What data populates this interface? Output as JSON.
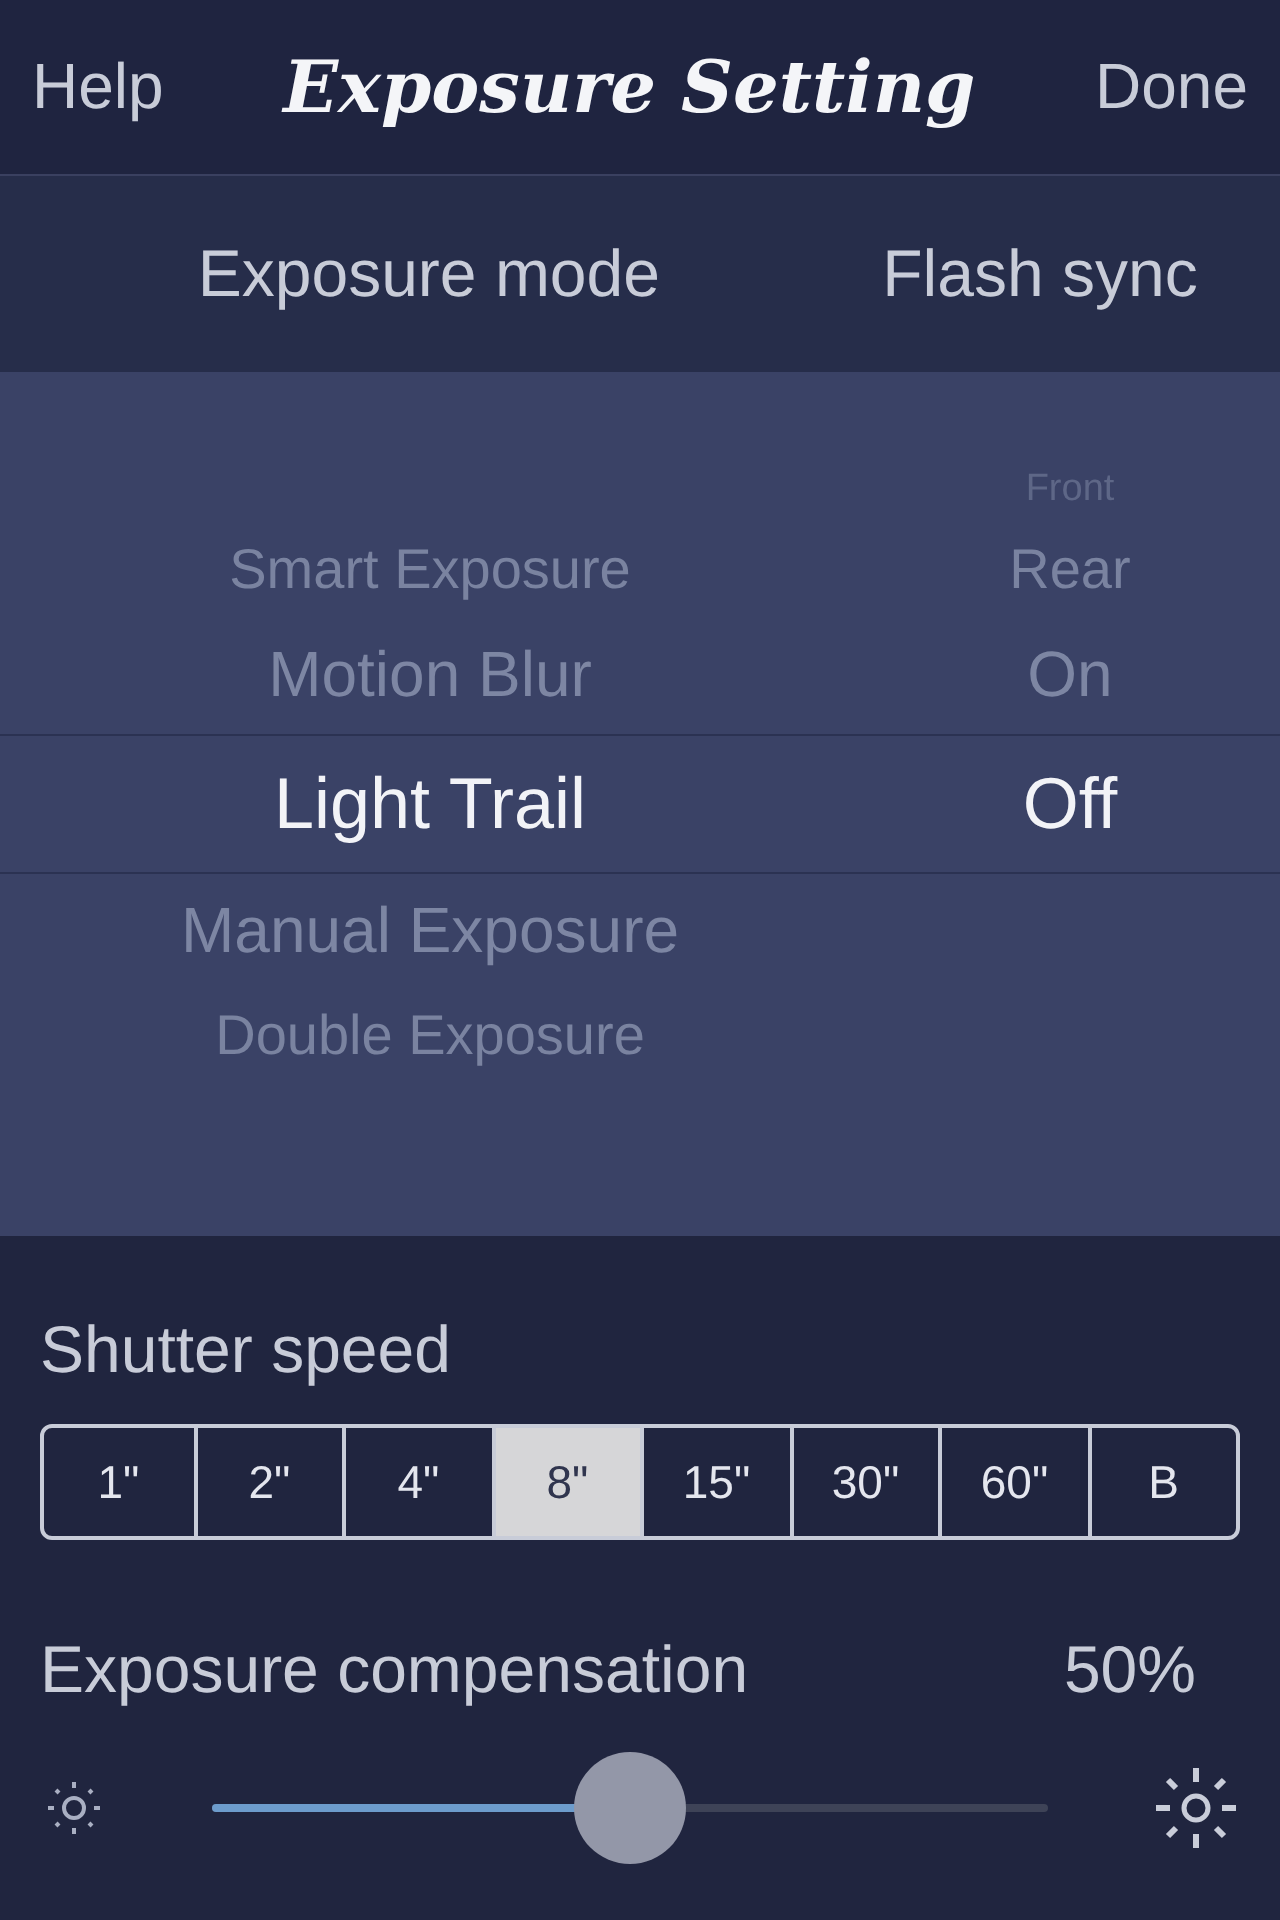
{
  "nav": {
    "left": "Help",
    "title": "Exposure Setting",
    "right": "Done"
  },
  "picker": {
    "columns": [
      {
        "heading": "Exposure mode",
        "items": [
          {
            "label": "Smart Exposure",
            "selected": false
          },
          {
            "label": "Motion Blur",
            "selected": false
          },
          {
            "label": "Light Trail",
            "selected": true
          },
          {
            "label": "Manual Exposure",
            "selected": false
          },
          {
            "label": "Double Exposure",
            "selected": false
          }
        ]
      },
      {
        "heading": "Flash sync",
        "items": [
          {
            "label": "Front",
            "selected": false
          },
          {
            "label": "Rear",
            "selected": false
          },
          {
            "label": "On",
            "selected": false
          },
          {
            "label": "Off",
            "selected": true
          }
        ]
      }
    ]
  },
  "shutter": {
    "label": "Shutter speed",
    "options": [
      {
        "label": "1\"",
        "selected": false
      },
      {
        "label": "2\"",
        "selected": false
      },
      {
        "label": "4\"",
        "selected": false
      },
      {
        "label": "8\"",
        "selected": true
      },
      {
        "label": "15\"",
        "selected": false
      },
      {
        "label": "30\"",
        "selected": false
      },
      {
        "label": "60\"",
        "selected": false
      },
      {
        "label": "B",
        "selected": false
      }
    ]
  },
  "compensation": {
    "label": "Exposure compensation",
    "reading": "50%",
    "level": 0.5
  }
}
